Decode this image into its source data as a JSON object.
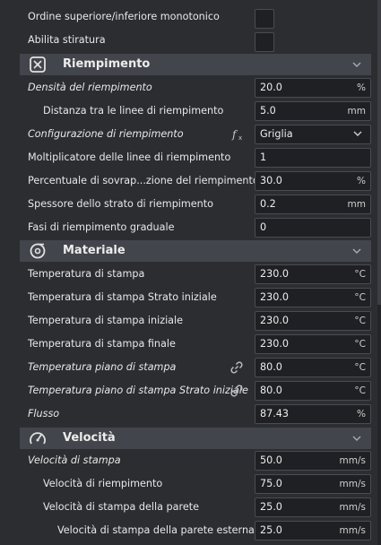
{
  "top_rows": [
    {
      "label": "Ordine superiore/inferiore monotonico"
    },
    {
      "label": "Abilita stiratura"
    }
  ],
  "sections": {
    "infill": {
      "title": "Riempimento",
      "icon": "infill-icon",
      "rows": [
        {
          "label": "Densità del riempimento",
          "value": "20.0",
          "unit": "%"
        },
        {
          "label": "Distanza tra le linee di riempimento",
          "value": "5.0",
          "unit": "mm"
        },
        {
          "label": "Configurazione di riempimento",
          "value": "Griglia",
          "unit": ""
        },
        {
          "label": "Moltiplicatore delle linee di riempimento",
          "value": "1",
          "unit": ""
        },
        {
          "label": "Percentuale di sovrap...zione del riempimento",
          "value": "30.0",
          "unit": "%"
        },
        {
          "label": "Spessore dello strato di riempimento",
          "value": "0.2",
          "unit": "mm"
        },
        {
          "label": "Fasi di riempimento graduale",
          "value": "0",
          "unit": ""
        }
      ]
    },
    "material": {
      "title": "Materiale",
      "icon": "material-spool-icon",
      "rows": [
        {
          "label": "Temperatura di stampa",
          "value": "230.0",
          "unit": "°C"
        },
        {
          "label": "Temperatura di stampa Strato iniziale",
          "value": "230.0",
          "unit": "°C"
        },
        {
          "label": "Temperatura di stampa iniziale",
          "value": "230.0",
          "unit": "°C"
        },
        {
          "label": "Temperatura di stampa finale",
          "value": "230.0",
          "unit": "°C"
        },
        {
          "label": "Temperatura piano di stampa",
          "value": "80.0",
          "unit": "°C"
        },
        {
          "label": "Temperatura piano di stampa Strato iniziale",
          "value": "80.0",
          "unit": "°C"
        },
        {
          "label": "Flusso",
          "value": "87.43",
          "unit": "%"
        }
      ]
    },
    "speed": {
      "title": "Velocità",
      "icon": "speedometer-icon",
      "rows": [
        {
          "label": "Velocità di stampa",
          "value": "50.0",
          "unit": "mm/s"
        },
        {
          "label": "Velocità di riempimento",
          "value": "75.0",
          "unit": "mm/s"
        },
        {
          "label": "Velocità di stampa della parete",
          "value": "25.0",
          "unit": "mm/s"
        },
        {
          "label": "Velocità di stampa della parete esterna",
          "value": "25.0",
          "unit": "mm/s"
        }
      ]
    }
  },
  "icons": {
    "function": "function-icon",
    "link": "link-icon",
    "section_collapse": "chevron-down-icon",
    "dropdown": "chevron-down-icon"
  },
  "colors": {
    "background": "#2b2d31",
    "section_header": "#42454b",
    "field_bg": "#1f2024",
    "field_border": "#4a4c52"
  }
}
